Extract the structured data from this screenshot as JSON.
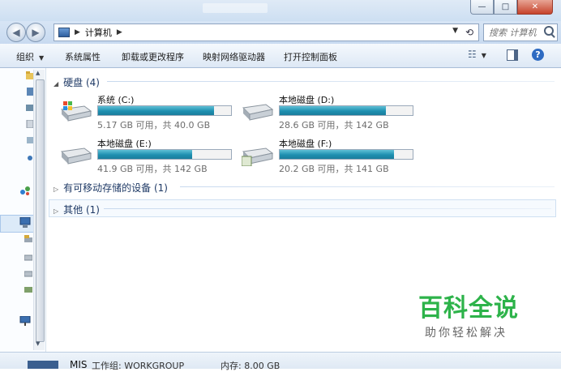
{
  "window": {
    "controls": {
      "minimize": "—",
      "maximize": "□",
      "close": "✕"
    }
  },
  "address_bar": {
    "path": [
      "计算机"
    ],
    "search_placeholder": "搜索 计算机"
  },
  "command_bar": {
    "organize": "组织",
    "system_properties": "系统属性",
    "uninstall": "卸载或更改程序",
    "map_drive": "映射网络驱动器",
    "control_panel": "打开控制面板",
    "help": "?"
  },
  "sections": {
    "hard_disks": "硬盘 (4)",
    "removable": "有可移动存储的设备 (1)",
    "other": "其他 (1)"
  },
  "drives": [
    {
      "name": "系统 (C:)",
      "free": "5.17 GB 可用，共 40.0 GB",
      "used_fraction": 0.87
    },
    {
      "name": "本地磁盘 (D:)",
      "free": "28.6 GB 可用，共 142 GB",
      "used_fraction": 0.8
    },
    {
      "name": "本地磁盘 (E:)",
      "free": "41.9 GB 可用，共 142 GB",
      "used_fraction": 0.71
    },
    {
      "name": "本地磁盘 (F:)",
      "free": "20.2 GB 可用，共 141 GB",
      "used_fraction": 0.86
    }
  ],
  "details": {
    "computer_name": "MIS",
    "workgroup": "工作组: WORKGROUP",
    "memory": "内存: 8.00 GB"
  },
  "watermark": {
    "main": "百科全说",
    "sub": "助你轻松解决"
  },
  "colors": {
    "accent": "#1e8fb0",
    "section_text": "#1f3a66",
    "watermark": "#2db34a"
  }
}
